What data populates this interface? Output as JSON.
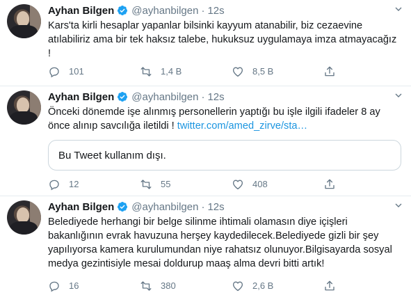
{
  "tweets": [
    {
      "name": "Ayhan Bilgen",
      "handle": "@ayhanbilgen",
      "sep": "·",
      "time": "12s",
      "text": "Kars'ta kirli hesaplar yapanlar bilsinki kayyum atanabilir, biz cezaevine atılabiliriz ama bir tek haksız talebe, hukuksuz uygulamaya imza atmayacağız !",
      "replies": "101",
      "retweets": "1,4 B",
      "likes": "8,5 B"
    },
    {
      "name": "Ayhan Bilgen",
      "handle": "@ayhanbilgen",
      "sep": "·",
      "time": "12s",
      "text": "Önceki dönemde işe alınmış personellerin yaptığı bu işle ilgili ifadeler 8 ay önce alınıp savcılığa iletildi ! ",
      "link": "twitter.com/amed_zirve/sta…",
      "quote": "Bu Tweet kullanım dışı.",
      "replies": "12",
      "retweets": "55",
      "likes": "408"
    },
    {
      "name": "Ayhan Bilgen",
      "handle": "@ayhanbilgen",
      "sep": "·",
      "time": "12s",
      "text": "Belediyede herhangi bir belge silinme ihtimali olamasın diye içişleri bakanlığının evrak havuzuna herşey kaydedilecek.Belediyede gizli bir şey yapılıyorsa kamera kurulumundan niye rahatsız olunuyor.Bilgisayarda sosyal medya gezintisiyle mesai doldurup maaş alma devri bitti artık!",
      "replies": "16",
      "retweets": "380",
      "likes": "2,6 B"
    }
  ],
  "colors": {
    "verified": "#1da1f2",
    "link": "#1b95e0",
    "muted": "#657786",
    "divider": "#e6ecf0"
  },
  "icons": [
    "verified-badge-icon",
    "chevron-down-icon",
    "reply-icon",
    "retweet-icon",
    "like-icon",
    "share-icon"
  ]
}
